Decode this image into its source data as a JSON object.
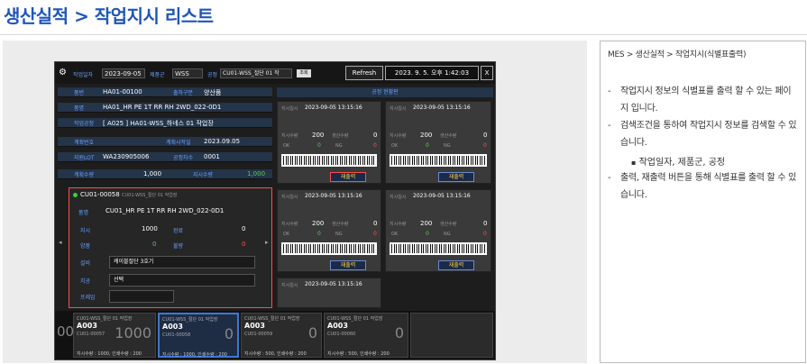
{
  "page": {
    "title": "생산실적 > 작업지시 리스트"
  },
  "note": {
    "breadcrumb": "MES > 생산실적 > 작업지시(식별표출력)",
    "bullet1": "작업지시 정보의 식별표를 출력 할 수 있는 페이지 입니다.",
    "bullet2": "검색조건을 통하여 작업지시 정보를 검색할 수 있습니다.",
    "sub1": "작업일자, 제품군, 공정",
    "bullet3": "출력, 재출력 버튼을 통해 식별표를 출력 할 수 있습니다.",
    "dash": "-",
    "dot": "▪"
  },
  "app": {
    "work_date_label": "작업일자",
    "work_date": "2023-09-05",
    "product_group_label": "제품군",
    "product_group": "WSS",
    "process_label": "공정",
    "process": "CU01-WSS_절단 01 작",
    "search_label": "조회",
    "refresh": "Refresh",
    "clock": "2023. 9. 5. 오후 1:42:03",
    "close": "X",
    "rows": [
      {
        "k": "품번",
        "v": "HA01-00100",
        "k2": "출하구분",
        "v2": "양산품"
      },
      {
        "k": "품명",
        "v": "HA01_HR PE 1T RR RH 2WD_022-0D1",
        "k2": "",
        "v2": ""
      },
      {
        "k": "작업공정",
        "v": "[ A025 ] HA01-WSS_하네스 01 작업장",
        "k2": "",
        "v2": ""
      },
      {
        "k": "계획번호",
        "v": "",
        "k2": "계획시작일",
        "v2": "2023.09.05"
      },
      {
        "k": "지원LOT",
        "v": "WA230905006",
        "k2": "공정차수",
        "v2": "0001"
      },
      {
        "k": "계획수량",
        "v": "1,000",
        "k2": "지시수량",
        "v2": "1,000"
      }
    ],
    "status_header": "공정 현황판",
    "cards": [
      {
        "date_label": "지시일시",
        "date": "2023-09-05 13:15:16",
        "p1": "지시수량",
        "n1": "200",
        "p2": "생산수량",
        "n2": "0",
        "ok": "OK",
        "okv": "0",
        "ng": "NG",
        "ngv": "0",
        "btn": "재출력"
      },
      {
        "date_label": "지시일시",
        "date": "2023-09-05 13:15:16",
        "p1": "지시수량",
        "n1": "200",
        "p2": "생산수량",
        "n2": "0",
        "ok": "OK",
        "okv": "0",
        "ng": "NG",
        "ngv": "0",
        "btn": "재출력"
      },
      {
        "date_label": "지시일시",
        "date": "2023-09-05 13:15:16",
        "p1": "지시수량",
        "n1": "200",
        "p2": "생산수량",
        "n2": "0",
        "ok": "OK",
        "okv": "0",
        "ng": "NG",
        "ngv": "0",
        "btn": "재출력"
      },
      {
        "date_label": "지시일시",
        "date": "2023-09-05 13:15:16",
        "p1": "지시수량",
        "n1": "200",
        "p2": "생산수량",
        "n2": "0",
        "ok": "OK",
        "okv": "0",
        "ng": "NG",
        "ngv": "0",
        "btn": "재출력"
      },
      {
        "date_label": "지시일시",
        "date": "2023-09-05 13:15:16",
        "p1": "",
        "n1": "",
        "p2": "",
        "n2": "",
        "ok": "",
        "okv": "",
        "ng": "",
        "ngv": "",
        "btn": ""
      }
    ],
    "detail": {
      "code": "CU01-00058",
      "sub": "CU01-WSS_절단 01 작업장",
      "name_label": "품명",
      "name": "CU01_HR PE 1T RR RH 2WD_022-0D1",
      "qty_label": "지시",
      "qty": "1000",
      "done_label": "완료",
      "done": "0",
      "good_label": "양품",
      "good": "0",
      "bad_label": "불량",
      "bad": "0",
      "equip_label": "설비",
      "equip": "케이블절단 3호기",
      "tool_label": "치공",
      "tool": "선택",
      "extra_label": "프레임",
      "extra": ""
    },
    "bottom_cards": [
      {
        "head": "CU01-WSS_절단 01 작업장",
        "code": "A003",
        "sub": "CU01-00057",
        "big": "1000",
        "foot": "지시수량 : 1000, 인쇄수량 : 200"
      },
      {
        "head": "CU01-WSS_절단 01 작업장",
        "code": "A003",
        "sub": "CU01-00058",
        "big": "0",
        "foot": "지시수량 : 1000, 인쇄수량 : 200"
      },
      {
        "head": "CU01-WSS_절단 01 작업장",
        "code": "A003",
        "sub": "CU01-00059",
        "big": "0",
        "foot": "지시수량 : 500, 인쇄수량 : 200"
      },
      {
        "head": "CU01-WSS_절단 01 작업장",
        "code": "A003",
        "sub": "CU01-00060",
        "big": "0",
        "foot": "지시수량 : 500, 인쇄수량 : 200"
      }
    ],
    "bottom_left": "00"
  }
}
